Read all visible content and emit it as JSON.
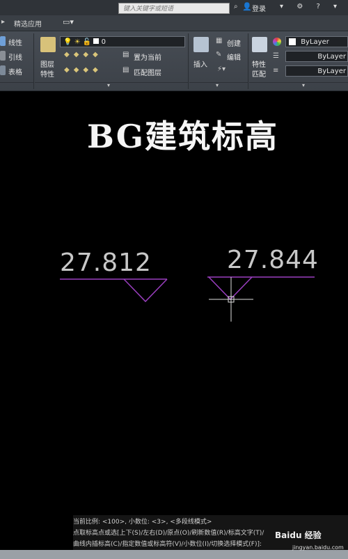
{
  "titlebar": {
    "search_placeholder": "键入关键字或短语",
    "login_label": "登录"
  },
  "tabs": [
    "精选应用"
  ],
  "ribbon": {
    "draw": {
      "line": "线性",
      "leader": "引线",
      "table": "表格"
    },
    "layer": {
      "panel_label_line1": "图层",
      "panel_label_line2": "特性",
      "current_layer": "0",
      "set_current": "置为当前",
      "match_layer": "匹配图层"
    },
    "block": {
      "insert": "插入",
      "create": "创建",
      "edit": "编辑"
    },
    "properties": {
      "label_line1": "特性",
      "label_line2": "匹配",
      "color": "ByLayer",
      "linetype": "ByLayer",
      "lineweight": "ByLayer"
    }
  },
  "canvas": {
    "title": "BG建筑标高",
    "elevation_left": "27.812",
    "elevation_right": "27.844",
    "marker_color": "#9b3fc0"
  },
  "command": {
    "line1": "当前比例: <100>, 小数位: <3>, <多段线模式>",
    "line2": "点取标高点或选[上下(S)/左右(D)/原点(O)/刷新数值(R)/标高文字(T)/",
    "line3": "曲线内插标高(C)/指定数值或标高符(V)/小数位(I)/切换选择模式(F)]:"
  },
  "watermark": {
    "brand": "Baidu 经验",
    "site": "jingyan.baidu.com"
  }
}
